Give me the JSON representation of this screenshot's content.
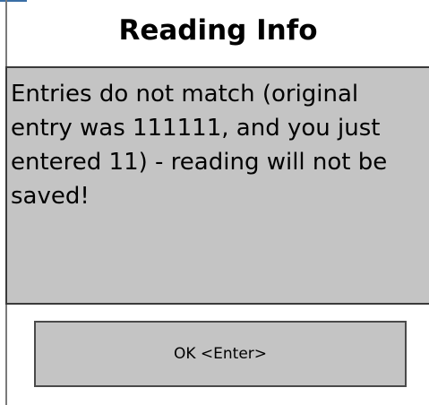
{
  "dialog": {
    "title": "Reading Info",
    "message": "Entries do not match (original entry was 111111, and you just entered 11) -  reading will not be saved!",
    "ok_label": "OK <Enter>"
  },
  "colors": {
    "panel_background": "#c4c4c4",
    "page_background": "#ffffff",
    "text": "#000000"
  }
}
